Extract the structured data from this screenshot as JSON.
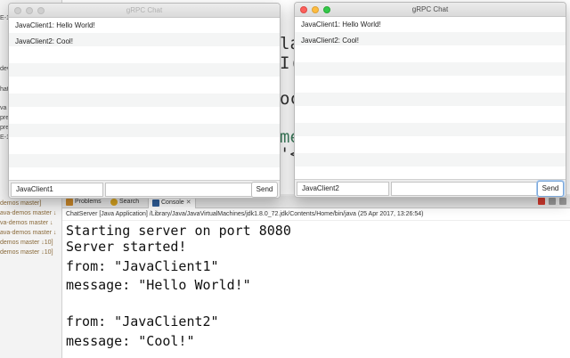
{
  "windows": [
    {
      "title": "gRPC Chat",
      "messages": [
        "JavaClient1: Hello World!",
        "JavaClient2: Cool!"
      ],
      "name_value": "JavaClient1",
      "message_value": "",
      "send_label": "Send"
    },
    {
      "title": "gRPC Chat",
      "messages": [
        "JavaClient1: Hello World!",
        "JavaClient2: Cool!"
      ],
      "name_value": "JavaClient2",
      "message_value": "",
      "send_label": "Send"
    }
  ],
  "eclipse": {
    "tabs": {
      "problems": "Problems",
      "search": "Search",
      "console": "Console"
    },
    "console_header": "ChatServer [Java Application] /Library/Java/JavaVirtualMachines/jdk1.8.0_72.jdk/Contents/Home/bin/java (25 Apr 2017, 13:26:54)",
    "console_lines": [
      "Starting server on port 8080",
      "Server started!",
      "from: \"JavaClient1\"",
      "message: \"Hello World!\"",
      "from: \"JavaClient2\"",
      "message: \"Cool!\""
    ],
    "package_explorer_rows": [
      "demos master]",
      "ava-demos master ↓",
      "va-demos master ↓",
      "ava-demos master ↓",
      "demos master ↓10]",
      "demos master ↓10]"
    ],
    "left_fragments": [
      "E-1",
      "dev",
      "hat",
      "va",
      "pre",
      "pre",
      "E-1"
    ],
    "code_fragments": [
      "la",
      "I(",
      "oc",
      "me",
      "'<"
    ]
  },
  "colors": {
    "close": "#fc605c",
    "minimize": "#fdbc40",
    "zoom": "#34c84a",
    "code_green": "#3f7f5f"
  },
  "icons": [
    "problems-icon",
    "search-icon",
    "console-icon",
    "close-tab-icon",
    "terminate-icon"
  ]
}
